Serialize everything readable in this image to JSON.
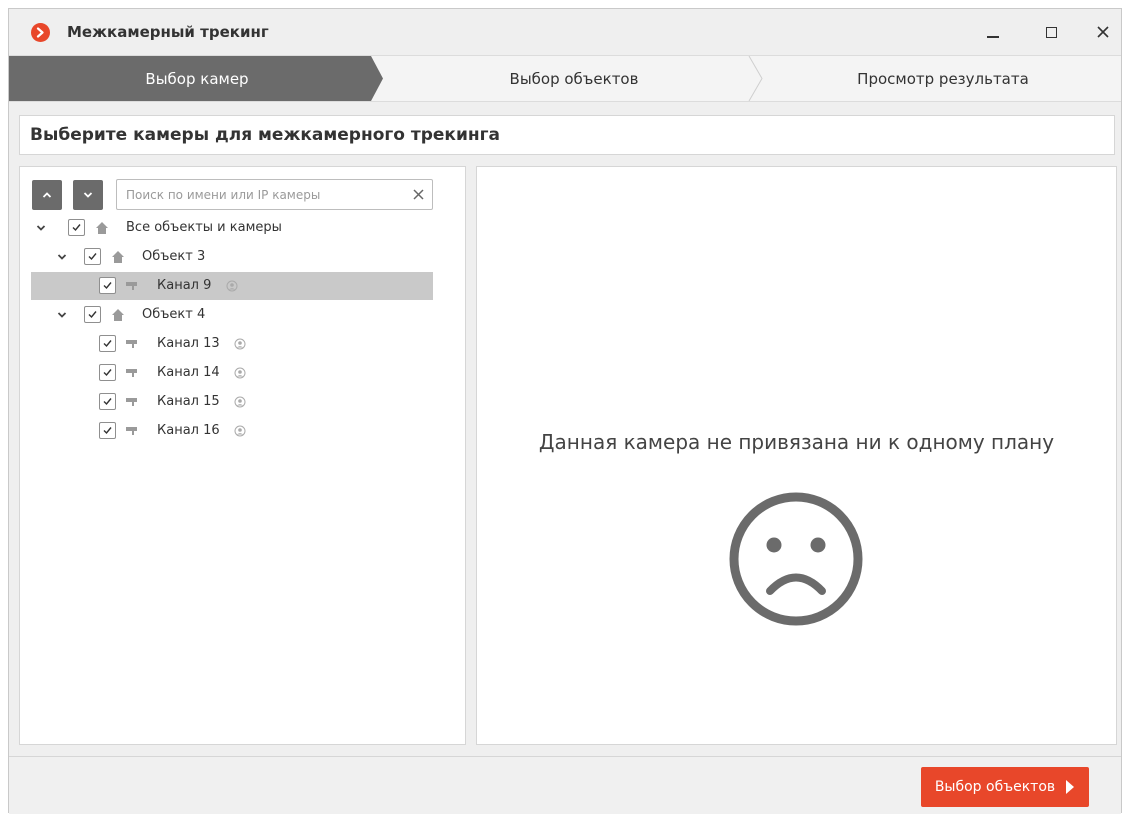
{
  "window": {
    "title": "Межкамерный трекинг",
    "accent_color": "#e8472a"
  },
  "steps": [
    {
      "label": "Выбор камер",
      "active": true
    },
    {
      "label": "Выбор объектов",
      "active": false
    },
    {
      "label": "Просмотр результата",
      "active": false
    }
  ],
  "heading": "Выберите камеры для межкамерного трекинга",
  "search": {
    "placeholder": "Поиск по имени или IP камеры",
    "value": ""
  },
  "tree": [
    {
      "label": "Все объекты и камеры",
      "type": "site",
      "checked": true,
      "expanded": true
    },
    {
      "label": "Объект 3",
      "type": "site",
      "checked": true,
      "expanded": true
    },
    {
      "label": "Канал 9",
      "type": "camera",
      "checked": true,
      "selected": true
    },
    {
      "label": "Объект 4",
      "type": "site",
      "checked": true,
      "expanded": true
    },
    {
      "label": "Канал 13",
      "type": "camera",
      "checked": true
    },
    {
      "label": "Канал 14",
      "type": "camera",
      "checked": true
    },
    {
      "label": "Канал 15",
      "type": "camera",
      "checked": true
    },
    {
      "label": "Канал 16",
      "type": "camera",
      "checked": true
    }
  ],
  "preview": {
    "message": "Данная камера не привязана ни к одному плану",
    "icon": "sad-face-icon"
  },
  "footer": {
    "next_label": "Выбор объектов"
  }
}
